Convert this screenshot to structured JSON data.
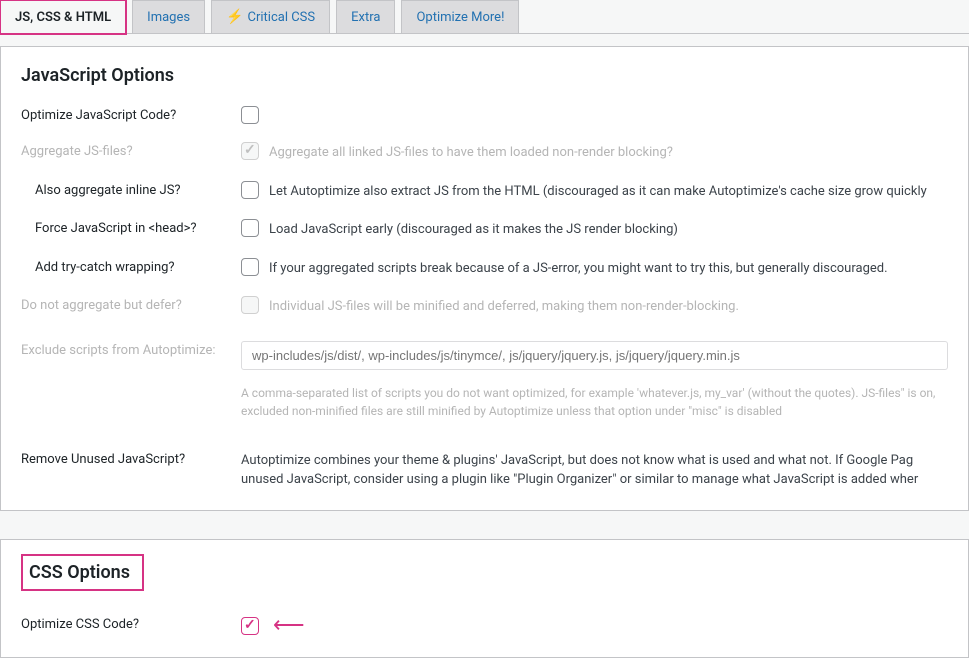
{
  "tabs": [
    {
      "label": "JS, CSS & HTML"
    },
    {
      "label": "Images"
    },
    {
      "label": "Critical CSS"
    },
    {
      "label": "Extra"
    },
    {
      "label": "Optimize More!"
    }
  ],
  "js_section": {
    "heading": "JavaScript Options",
    "optimize_js_label": "Optimize JavaScript Code?",
    "aggregate_js_label": "Aggregate JS-files?",
    "aggregate_js_desc": "Aggregate all linked JS-files to have them loaded non-render blocking?",
    "inline_js_label": "Also aggregate inline JS?",
    "inline_js_desc": "Let Autoptimize also extract JS from the HTML (discouraged as it can make Autoptimize's cache size grow quickly",
    "force_head_label": "Force JavaScript in <head>?",
    "force_head_desc": "Load JavaScript early (discouraged as it makes the JS render blocking)",
    "trycatch_label": "Add try-catch wrapping?",
    "trycatch_desc": "If your aggregated scripts break because of a JS-error, you might want to try this, but generally discouraged.",
    "defer_label": "Do not aggregate but defer?",
    "defer_desc": "Individual JS-files will be minified and deferred, making them non-render-blocking.",
    "exclude_label": "Exclude scripts from Autoptimize:",
    "exclude_placeholder": "wp-includes/js/dist/, wp-includes/js/tinymce/, js/jquery/jquery.js, js/jquery/jquery.min.js",
    "exclude_help": "A comma-separated list of scripts you do not want optimized, for example 'whatever.js, my_var' (without the quotes). JS-files\" is on, excluded non-minified files are still minified by Autoptimize unless that option under \"misc\" is disabled",
    "remove_unused_label": "Remove Unused JavaScript?",
    "remove_unused_desc": "Autoptimize combines your theme & plugins' JavaScript, but does not know what is used and what not. If Google Pag unused JavaScript, consider using a plugin like \"Plugin Organizer\" or similar to manage what JavaScript is added wher"
  },
  "css_section": {
    "heading": "CSS Options",
    "optimize_css_label": "Optimize CSS Code?"
  }
}
